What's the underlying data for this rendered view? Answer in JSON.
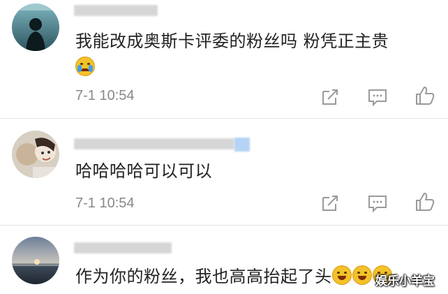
{
  "comments": [
    {
      "username": "",
      "text": "我能改成奥斯卡评委的粉丝吗 粉凭正主贵",
      "emoji": "crying-face-emoji",
      "time": "7-1 10:54"
    },
    {
      "username": "",
      "text": "哈哈哈哈可以可以",
      "time": "7-1 10:54"
    },
    {
      "username": "",
      "text": "作为你的粉丝，我也高高抬起了头",
      "emoji": "laughing-face-emoji x3"
    }
  ],
  "actions": [
    "share-icon",
    "comment-icon",
    "like-icon"
  ],
  "watermark": "娱乐小羊宝",
  "colors": {
    "text": "#222222",
    "time": "#888888",
    "icon": "#9a9a9a"
  }
}
